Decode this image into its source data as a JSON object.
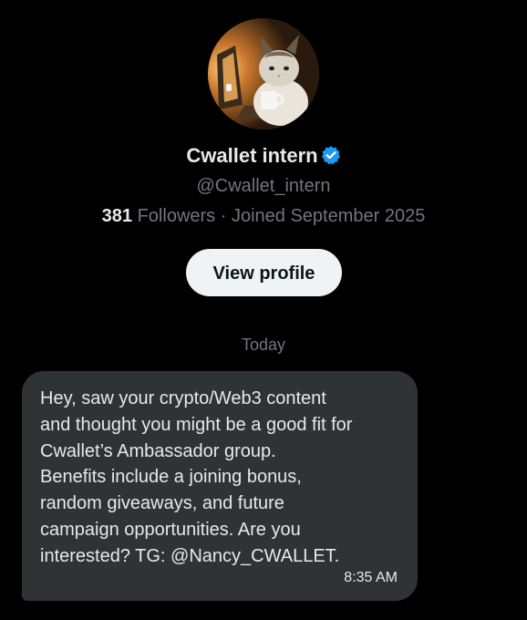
{
  "profile": {
    "display_name": "Cwallet intern",
    "handle": "@Cwallet_intern",
    "followers_count": "381",
    "followers_label": "Followers",
    "separator": "·",
    "joined": "Joined September 2025",
    "verified_icon": "verified-badge-icon",
    "view_profile_label": "View profile"
  },
  "conversation": {
    "day_label": "Today",
    "message": {
      "lines": [
        "Hey, saw your crypto/Web3 content",
        "and thought you might be a good fit for",
        "Cwallet’s Ambassador group.",
        "Benefits include a joining bonus,",
        "random giveaways, and future",
        "campaign opportunities. Are you",
        "interested? TG: @Nancy_CWALLET."
      ],
      "time": "8:35 AM"
    }
  },
  "colors": {
    "background": "#000000",
    "primary_text": "#e7e9ea",
    "secondary_text": "#71767b",
    "bubble": "#2f3336",
    "button_bg": "#eff3f4",
    "verified_blue": "#1d9bf0"
  }
}
